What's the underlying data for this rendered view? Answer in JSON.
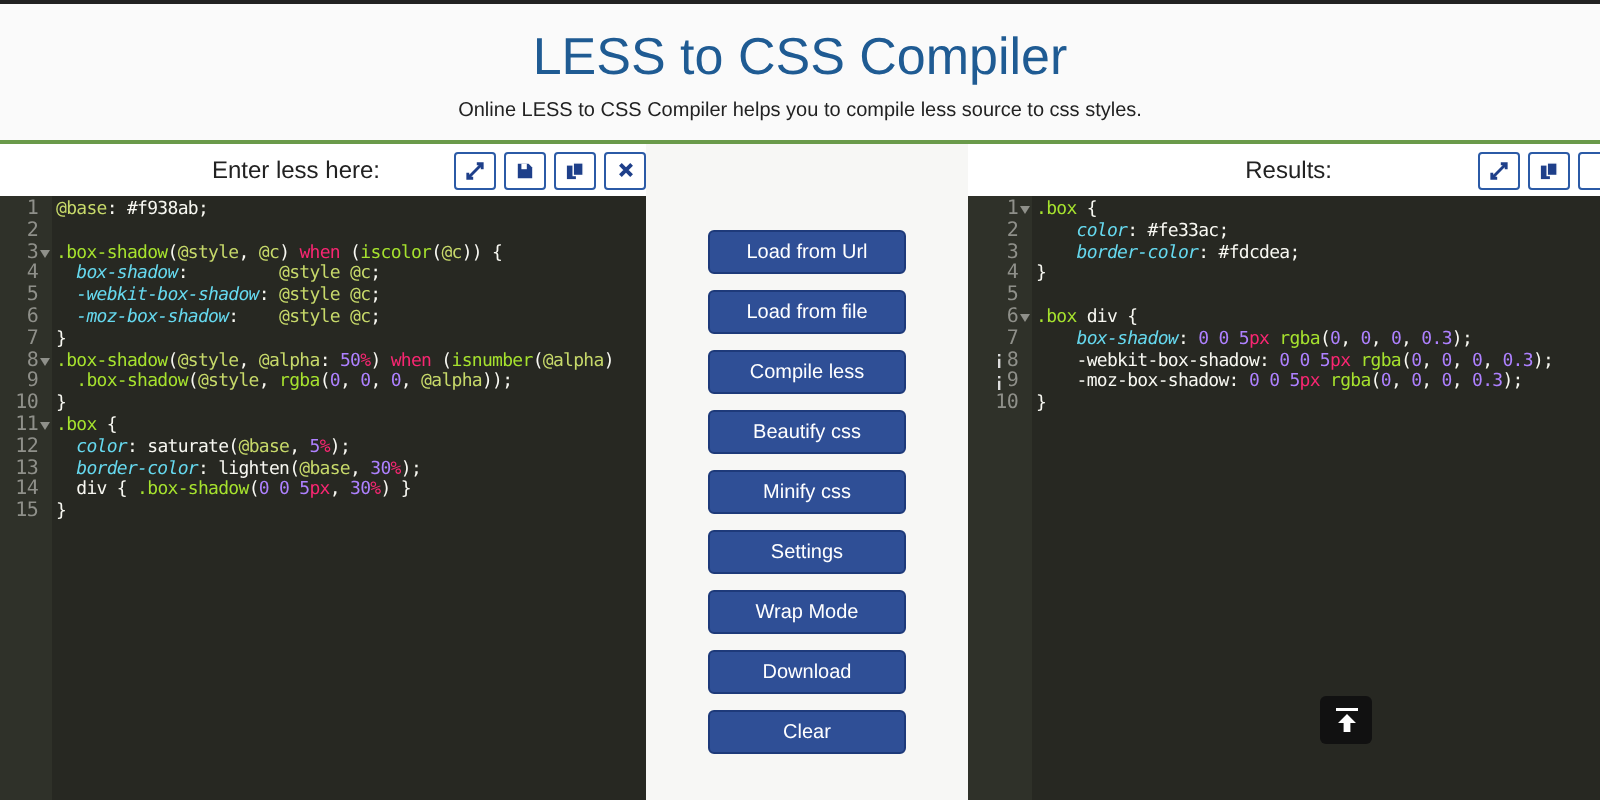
{
  "header": {
    "title": "LESS to CSS Compiler",
    "subtitle": "Online LESS to CSS Compiler helps you to compile less source to css styles."
  },
  "input_panel": {
    "label": "Enter less here:",
    "lines": [
      {
        "number": "1",
        "fold": false,
        "tokens": [
          {
            "t": "@base",
            "kind": "variable"
          },
          {
            "t": ": #f938ab;",
            "kind": "plain"
          }
        ]
      },
      {
        "number": "2",
        "fold": false
      },
      {
        "number": "3",
        "fold": true,
        "tokens": [
          {
            "t": ".box-shadow",
            "kind": "selector"
          },
          {
            "t": "(",
            "kind": "plain"
          },
          {
            "t": "@style",
            "kind": "variable"
          },
          {
            "t": ",",
            "kind": "plain"
          },
          {
            "t": " @c",
            "kind": "variable"
          },
          {
            "t": ")",
            "kind": "plain"
          },
          {
            "t": " when",
            "kind": "keyword"
          },
          {
            "t": " (",
            "kind": "plain"
          },
          {
            "t": "iscolor",
            "kind": "selector"
          },
          {
            "t": "(",
            "kind": "plain"
          },
          {
            "t": "@c",
            "kind": "variable"
          },
          {
            "t": ")) {",
            "kind": "plain"
          }
        ]
      },
      {
        "number": "4",
        "fold": false,
        "tokens": [
          {
            "t": "  box-shadow",
            "kind": "property"
          },
          {
            "t": ":         ",
            "kind": "plain"
          },
          {
            "t": "@style @c",
            "kind": "variable"
          },
          {
            "t": ";",
            "kind": "plain"
          }
        ]
      },
      {
        "number": "5",
        "fold": false,
        "tokens": [
          {
            "t": "  -webkit-box-shadow",
            "kind": "property"
          },
          {
            "t": ": ",
            "kind": "plain"
          },
          {
            "t": "@style @c",
            "kind": "variable"
          },
          {
            "t": ";",
            "kind": "plain"
          }
        ]
      },
      {
        "number": "6",
        "fold": false,
        "tokens": [
          {
            "t": "  -moz-box-shadow",
            "kind": "property"
          },
          {
            "t": ":    ",
            "kind": "plain"
          },
          {
            "t": "@style @c",
            "kind": "variable"
          },
          {
            "t": ";",
            "kind": "plain"
          }
        ]
      },
      {
        "number": "7",
        "fold": false,
        "tokens": [
          {
            "t": "}",
            "kind": "plain"
          }
        ]
      },
      {
        "number": "8",
        "fold": true,
        "tokens": [
          {
            "t": ".box-shadow",
            "kind": "selector"
          },
          {
            "t": "(",
            "kind": "plain"
          },
          {
            "t": "@style",
            "kind": "variable"
          },
          {
            "t": ",",
            "kind": "plain"
          },
          {
            "t": " @alpha",
            "kind": "variable"
          },
          {
            "t": ": ",
            "kind": "plain"
          },
          {
            "t": "50",
            "kind": "number"
          },
          {
            "t": "%",
            "kind": "unit"
          },
          {
            "t": ")",
            "kind": "plain"
          },
          {
            "t": " when",
            "kind": "keyword"
          },
          {
            "t": " (",
            "kind": "plain"
          },
          {
            "t": "isnumber",
            "kind": "selector"
          },
          {
            "t": "(",
            "kind": "plain"
          },
          {
            "t": "@alpha",
            "kind": "variable"
          },
          {
            "t": ")",
            "kind": "plain"
          }
        ]
      },
      {
        "number": "9",
        "fold": false,
        "tokens": [
          {
            "t": "  .box-shadow",
            "kind": "selector"
          },
          {
            "t": "(",
            "kind": "plain"
          },
          {
            "t": "@style",
            "kind": "variable"
          },
          {
            "t": ",",
            "kind": "plain"
          },
          {
            "t": " rgba",
            "kind": "selector"
          },
          {
            "t": "(",
            "kind": "plain"
          },
          {
            "t": "0",
            "kind": "number"
          },
          {
            "t": ",",
            "kind": "plain"
          },
          {
            "t": " 0",
            "kind": "number"
          },
          {
            "t": ",",
            "kind": "plain"
          },
          {
            "t": " 0",
            "kind": "number"
          },
          {
            "t": ",",
            "kind": "plain"
          },
          {
            "t": " @alpha",
            "kind": "variable"
          },
          {
            "t": "));",
            "kind": "plain"
          }
        ]
      },
      {
        "number": "10",
        "fold": false,
        "tokens": [
          {
            "t": "}",
            "kind": "plain"
          }
        ]
      },
      {
        "number": "11",
        "fold": true,
        "tokens": [
          {
            "t": ".box",
            "kind": "selector"
          },
          {
            "t": " {",
            "kind": "plain"
          }
        ]
      },
      {
        "number": "12",
        "fold": false,
        "tokens": [
          {
            "t": "  color",
            "kind": "property"
          },
          {
            "t": ": saturate(",
            "kind": "plain"
          },
          {
            "t": "@base",
            "kind": "variable"
          },
          {
            "t": ",",
            "kind": "plain"
          },
          {
            "t": " 5",
            "kind": "number"
          },
          {
            "t": "%",
            "kind": "unit"
          },
          {
            "t": ");",
            "kind": "plain"
          }
        ]
      },
      {
        "number": "13",
        "fold": false,
        "tokens": [
          {
            "t": "  border-color",
            "kind": "property"
          },
          {
            "t": ": lighten(",
            "kind": "plain"
          },
          {
            "t": "@base",
            "kind": "variable"
          },
          {
            "t": ",",
            "kind": "plain"
          },
          {
            "t": " 30",
            "kind": "number"
          },
          {
            "t": "%",
            "kind": "unit"
          },
          {
            "t": ");",
            "kind": "plain"
          }
        ]
      },
      {
        "number": "14",
        "fold": false,
        "tokens": [
          {
            "t": "  div {",
            "kind": "plain"
          },
          {
            "t": " .box-shadow",
            "kind": "selector"
          },
          {
            "t": "(",
            "kind": "plain"
          },
          {
            "t": "0 0 5",
            "kind": "number"
          },
          {
            "t": "px",
            "kind": "unit"
          },
          {
            "t": ",",
            "kind": "plain"
          },
          {
            "t": " 30",
            "kind": "number"
          },
          {
            "t": "%",
            "kind": "unit"
          },
          {
            "t": ") }",
            "kind": "plain"
          }
        ]
      },
      {
        "number": "15",
        "fold": false,
        "tokens": [
          {
            "t": "}",
            "kind": "plain"
          }
        ]
      }
    ]
  },
  "buttons": [
    "Load from Url",
    "Load from file",
    "Compile less",
    "Beautify css",
    "Minify css",
    "Settings",
    "Wrap Mode",
    "Download",
    "Clear"
  ],
  "output_panel": {
    "label": "Results:",
    "lines": [
      {
        "number": "1",
        "fold": true,
        "warning": false,
        "tokens": [
          {
            "t": ".box",
            "kind": "selector"
          },
          {
            "t": " {",
            "kind": "plain"
          }
        ]
      },
      {
        "number": "2",
        "fold": false,
        "warning": false,
        "tokens": [
          {
            "t": "    color",
            "kind": "property"
          },
          {
            "t": ": #fe33ac;",
            "kind": "plain"
          }
        ]
      },
      {
        "number": "3",
        "fold": false,
        "warning": false,
        "tokens": [
          {
            "t": "    border-color",
            "kind": "property"
          },
          {
            "t": ": #fdcdea;",
            "kind": "plain"
          }
        ]
      },
      {
        "number": "4",
        "fold": false,
        "warning": false,
        "tokens": [
          {
            "t": "}",
            "kind": "plain"
          }
        ]
      },
      {
        "number": "5",
        "fold": false,
        "warning": false
      },
      {
        "number": "6",
        "fold": true,
        "warning": false,
        "tokens": [
          {
            "t": ".box",
            "kind": "selector"
          },
          {
            "t": " div {",
            "kind": "plain"
          }
        ]
      },
      {
        "number": "7",
        "fold": false,
        "warning": false,
        "tokens": [
          {
            "t": "    box-shadow",
            "kind": "property"
          },
          {
            "t": ": ",
            "kind": "plain"
          },
          {
            "t": "0 0 5",
            "kind": "number"
          },
          {
            "t": "px",
            "kind": "unit"
          },
          {
            "t": " rgba",
            "kind": "selector"
          },
          {
            "t": "(",
            "kind": "plain"
          },
          {
            "t": "0",
            "kind": "number"
          },
          {
            "t": ",",
            "kind": "plain"
          },
          {
            "t": " 0",
            "kind": "number"
          },
          {
            "t": ",",
            "kind": "plain"
          },
          {
            "t": " 0",
            "kind": "number"
          },
          {
            "t": ",",
            "kind": "plain"
          },
          {
            "t": " 0.3",
            "kind": "number"
          },
          {
            "t": ");",
            "kind": "plain"
          }
        ]
      },
      {
        "number": "8",
        "fold": false,
        "warning": true,
        "tokens": [
          {
            "t": "    -webkit-box-shadow: ",
            "kind": "plain"
          },
          {
            "t": "0 0 5",
            "kind": "number"
          },
          {
            "t": "px",
            "kind": "unit"
          },
          {
            "t": " rgba",
            "kind": "selector"
          },
          {
            "t": "(",
            "kind": "plain"
          },
          {
            "t": "0",
            "kind": "number"
          },
          {
            "t": ",",
            "kind": "plain"
          },
          {
            "t": " 0",
            "kind": "number"
          },
          {
            "t": ",",
            "kind": "plain"
          },
          {
            "t": " 0",
            "kind": "number"
          },
          {
            "t": ",",
            "kind": "plain"
          },
          {
            "t": " 0.3",
            "kind": "number"
          },
          {
            "t": ");",
            "kind": "plain"
          }
        ]
      },
      {
        "number": "9",
        "fold": false,
        "warning": true,
        "tokens": [
          {
            "t": "    -moz-box-shadow: ",
            "kind": "plain"
          },
          {
            "t": "0 0 5",
            "kind": "number"
          },
          {
            "t": "px",
            "kind": "unit"
          },
          {
            "t": " rgba",
            "kind": "selector"
          },
          {
            "t": "(",
            "kind": "plain"
          },
          {
            "t": "0",
            "kind": "number"
          },
          {
            "t": ",",
            "kind": "plain"
          },
          {
            "t": " 0",
            "kind": "number"
          },
          {
            "t": ",",
            "kind": "plain"
          },
          {
            "t": " 0",
            "kind": "number"
          },
          {
            "t": ",",
            "kind": "plain"
          },
          {
            "t": " 0.3",
            "kind": "number"
          },
          {
            "t": ");",
            "kind": "plain"
          }
        ]
      },
      {
        "number": "10",
        "fold": false,
        "warning": false,
        "tokens": [
          {
            "t": "}",
            "kind": "plain"
          }
        ]
      }
    ]
  }
}
